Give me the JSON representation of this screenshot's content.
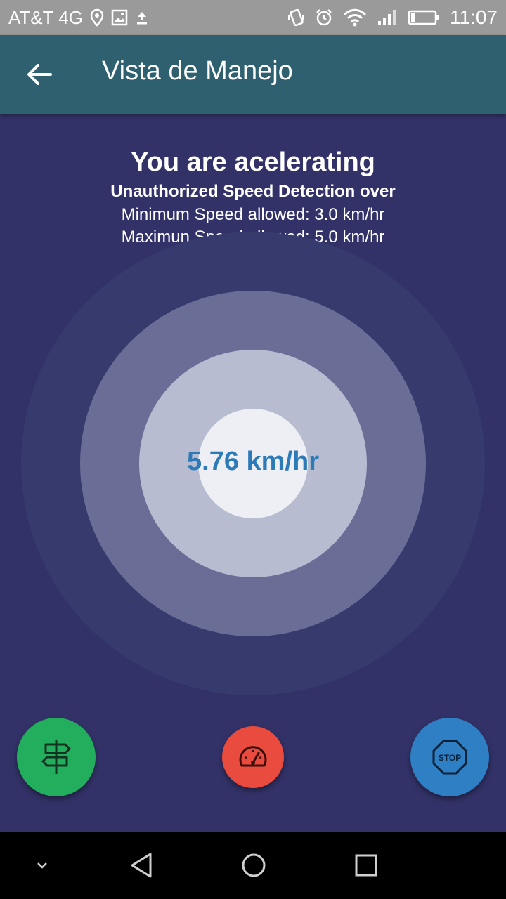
{
  "status_bar": {
    "carrier": "AT&T 4G",
    "time": "11:07",
    "icons_left": [
      "location-icon",
      "image-icon",
      "upload-icon"
    ],
    "icons_right": [
      "vibrate-icon",
      "alarm-icon",
      "wifi-icon",
      "signal-icon",
      "battery-icon"
    ]
  },
  "app_bar": {
    "title": "Vista de Manejo",
    "back_icon": "arrow-left-icon"
  },
  "header": {
    "title": "You are acelerating",
    "subtitle": "Unauthorized Speed Detection over",
    "min_speed": "Minimum Speed allowed: 3.0 km/hr",
    "max_speed": "Maximun Speed allowed: 5.0 km/hr"
  },
  "speedometer": {
    "value": "5.76 km/hr",
    "color": "#2c7ab8"
  },
  "actions": {
    "route_button": {
      "icon": "signpost-icon",
      "color": "#23ae5e"
    },
    "speed_button": {
      "icon": "speedometer-icon",
      "color": "#e94c3e"
    },
    "stop_button": {
      "icon": "stop-sign-icon",
      "label": "STOP",
      "color": "#2e7fc4"
    }
  },
  "nav_bar": {
    "icons": [
      "chevron-down-icon",
      "back-triangle-icon",
      "home-circle-icon",
      "recents-square-icon"
    ]
  },
  "colors": {
    "background": "#323268",
    "app_bar": "#2e6070",
    "status_bar": "#9a9a9a"
  }
}
